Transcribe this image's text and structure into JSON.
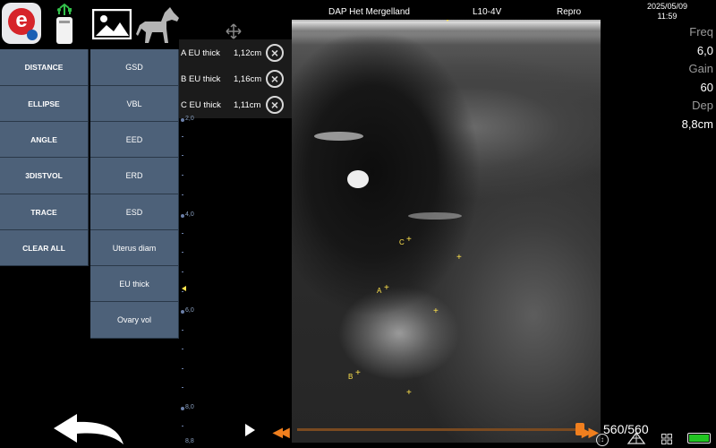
{
  "header": {
    "clinic": "DAP Het Mergelland",
    "probe": "L10-4V",
    "preset": "Repro",
    "date": "2025/05/09",
    "time": "11:59"
  },
  "left_buttons": [
    "DISTANCE",
    "ELLIPSE",
    "ANGLE",
    "3DISTVOL",
    "TRACE",
    "CLEAR ALL"
  ],
  "right_buttons": [
    "GSD",
    "VBL",
    "EED",
    "ERD",
    "ESD",
    "Uterus diam",
    "EU thick",
    "Ovary vol"
  ],
  "measurements": [
    {
      "label": "A  EU thick",
      "value": "1,12cm"
    },
    {
      "label": "B  EU thick",
      "value": "1,16cm"
    },
    {
      "label": "C  EU thick",
      "value": "1,11cm"
    }
  ],
  "depth_scale": [
    "2,0",
    "4,0",
    "6,0",
    "8,0",
    "8,8"
  ],
  "image_markers": [
    "A",
    "B",
    "C"
  ],
  "info": {
    "freq_label": "Freq",
    "freq_value": "6,0",
    "gain_label": "Gain",
    "gain_value": "60",
    "depth_label": "Dep",
    "depth_value": "8,8cm"
  },
  "cine": {
    "frames": "560/560",
    "position": 1.0
  },
  "colors": {
    "button_bg": "#4d6179",
    "accent_orange": "#f07f1e",
    "marker_yellow": "#ffe34d",
    "battery_green": "#22c522"
  },
  "icons": [
    "app-logo-icon",
    "usb-icon",
    "image-icon",
    "horse-icon",
    "move-icon",
    "back-arrow-icon",
    "play-icon",
    "rewind-icon",
    "fast-forward-icon",
    "symmetry-icon",
    "probe-icon",
    "grid-icon",
    "battery-icon"
  ]
}
